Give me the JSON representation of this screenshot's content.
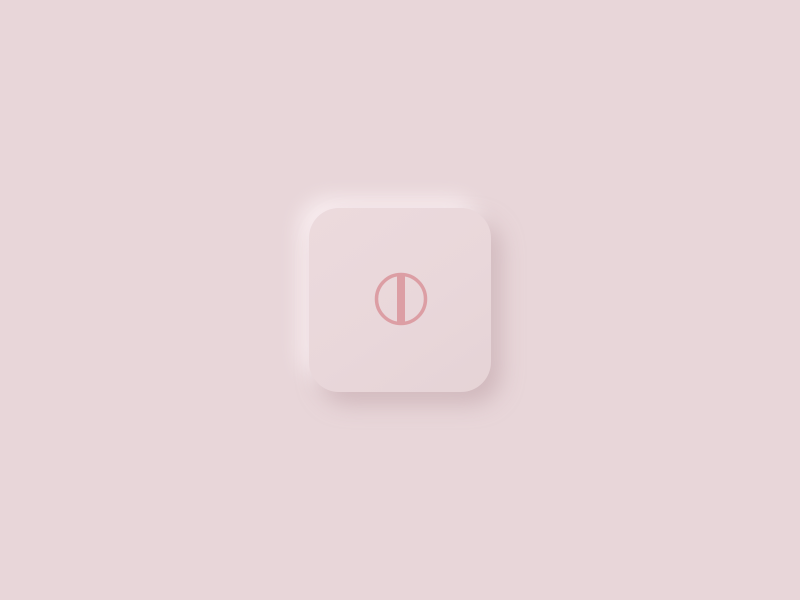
{
  "app": {
    "background_color": "#e8d6d9"
  },
  "tile": {
    "icon": "circle-split-icon",
    "surface_color": "#e9d7da",
    "icon_color": "#dc9ea4"
  }
}
